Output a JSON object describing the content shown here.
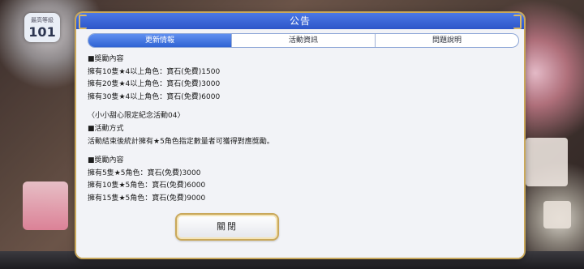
{
  "background": {
    "badge_label": "最高等級",
    "badge_value": "101"
  },
  "dialog": {
    "title": "公告",
    "tabs": [
      {
        "label": "更新情報",
        "active": true
      },
      {
        "label": "活動資訊",
        "active": false
      },
      {
        "label": "問題說明",
        "active": false
      }
    ],
    "content": [
      "■獎勵內容",
      "擁有10隻★4以上角色：寶石(免費)1500",
      "擁有20隻★4以上角色：寶石(免費)3000",
      "擁有30隻★4以上角色：寶石(免費)6000",
      "",
      "〈小小甜心限定紀念活動04〉",
      "■活動方式",
      "活動結束後統計擁有★5角色指定數量者可獲得對應獎勵。",
      "",
      "■獎勵內容",
      "擁有5隻★5角色：寶石(免費)3000",
      "擁有10隻★5角色：寶石(免費)6000",
      "擁有15隻★5角色：寶石(免費)9000"
    ],
    "close_label": "關閉"
  },
  "colors": {
    "title_bar": "#3a66d8",
    "tab_active": "#3f72de",
    "gold_border": "#c9a85b"
  }
}
